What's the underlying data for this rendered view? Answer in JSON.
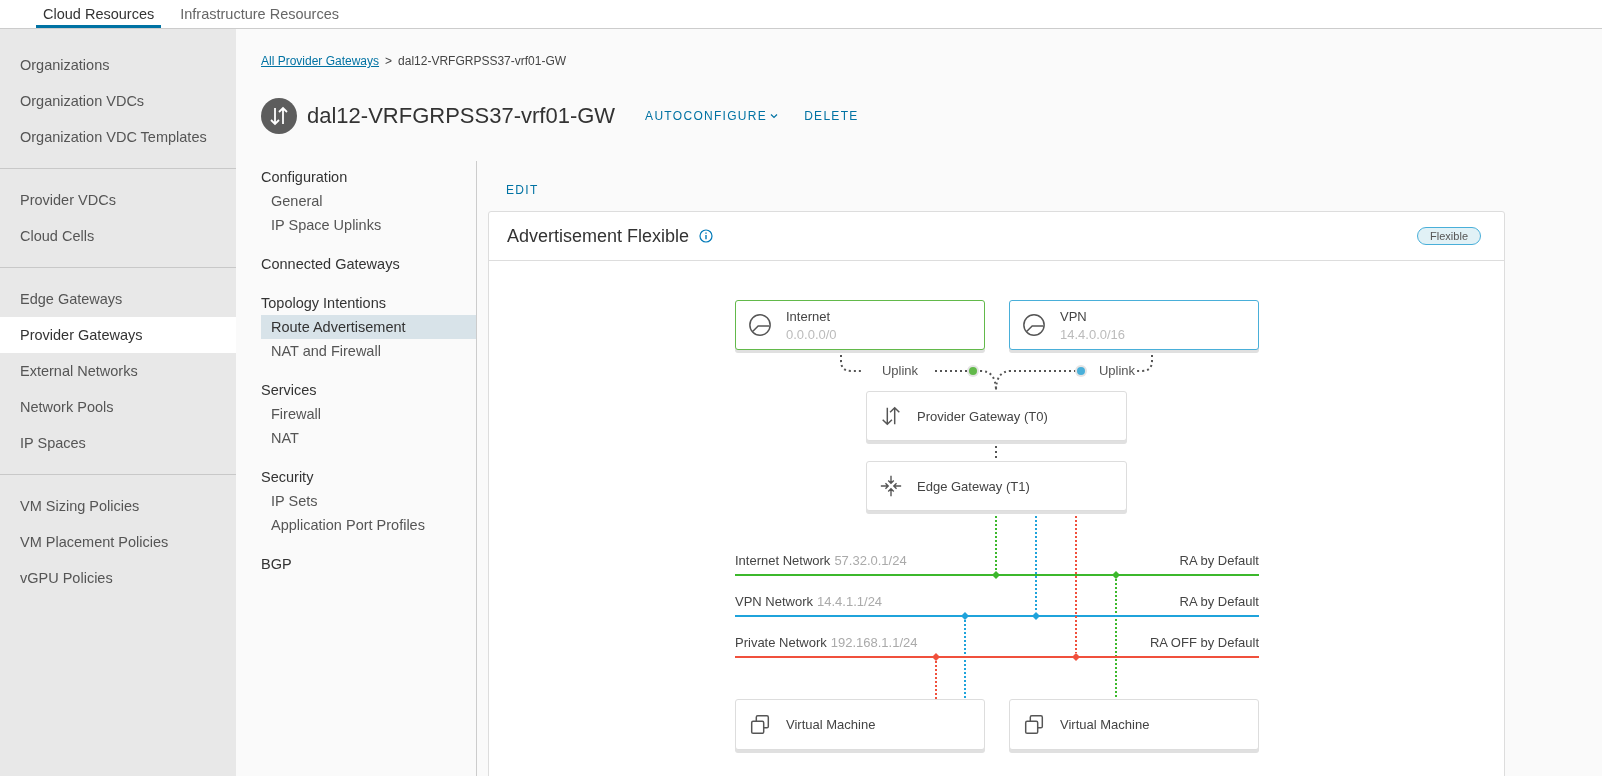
{
  "tabs": [
    {
      "label": "Cloud Resources",
      "selected": true
    },
    {
      "label": "Infrastructure Resources",
      "selected": false
    }
  ],
  "sidebar": {
    "groups": [
      {
        "items": [
          {
            "label": "Organizations",
            "selected": false
          },
          {
            "label": "Organization VDCs",
            "selected": false
          },
          {
            "label": "Organization VDC Templates",
            "selected": false
          }
        ]
      },
      {
        "items": [
          {
            "label": "Provider VDCs",
            "selected": false
          },
          {
            "label": "Cloud Cells",
            "selected": false
          }
        ]
      },
      {
        "items": [
          {
            "label": "Edge Gateways",
            "selected": false
          },
          {
            "label": "Provider Gateways",
            "selected": true
          },
          {
            "label": "External Networks",
            "selected": false
          },
          {
            "label": "Network Pools",
            "selected": false
          },
          {
            "label": "IP Spaces",
            "selected": false
          }
        ]
      },
      {
        "items": [
          {
            "label": "VM Sizing Policies",
            "selected": false
          },
          {
            "label": "VM Placement Policies",
            "selected": false
          },
          {
            "label": "vGPU Policies",
            "selected": false
          }
        ]
      }
    ]
  },
  "breadcrumb": {
    "link": "All Provider Gateways",
    "separator": ">",
    "current": "dal12-VRFGRPSS37-vrf01-GW"
  },
  "page_title": "dal12-VRFGRPSS37-vrf01-GW",
  "actions": [
    {
      "label": "AUTOCONFIGURE",
      "dropdown": true
    },
    {
      "label": "DELETE",
      "dropdown": false
    }
  ],
  "subnav": [
    {
      "heading": "Configuration",
      "items": [
        {
          "label": "General",
          "selected": false
        },
        {
          "label": "IP Space Uplinks",
          "selected": false
        }
      ]
    },
    {
      "heading": "Connected Gateways"
    },
    {
      "heading": "Topology Intentions",
      "items": [
        {
          "label": "Route Advertisement",
          "selected": true
        },
        {
          "label": "NAT and Firewall",
          "selected": false
        }
      ]
    },
    {
      "heading": "Services",
      "items": [
        {
          "label": "Firewall",
          "selected": false
        },
        {
          "label": "NAT",
          "selected": false
        }
      ]
    },
    {
      "heading": "Security",
      "items": [
        {
          "label": "IP Sets",
          "selected": false
        },
        {
          "label": "Application Port Profiles",
          "selected": false
        }
      ]
    },
    {
      "heading": "BGP"
    }
  ],
  "edit_button": "EDIT",
  "card": {
    "title": "Advertisement Flexible",
    "badge": "Flexible",
    "diagram": {
      "uplinks": [
        {
          "name": "Internet",
          "cidr": "0.0.0.0/0",
          "color": "#62b94a",
          "link_label": "Uplink"
        },
        {
          "name": "VPN",
          "cidr": "14.4.0.0/16",
          "color": "#49afd9",
          "link_label": "Uplink"
        }
      ],
      "provider_gateway": "Provider Gateway (T0)",
      "edge_gateway": "Edge Gateway (T1)",
      "networks": [
        {
          "name": "Internet Network",
          "cidr": "57.32.0.1/24",
          "status": "RA by Default",
          "color": "#3cb82c"
        },
        {
          "name": "VPN Network",
          "cidr": "14.4.1.1/24",
          "status": "RA by Default",
          "color": "#1fa3db"
        },
        {
          "name": "Private Network",
          "cidr": "192.168.1.1/24",
          "status": "RA OFF by Default",
          "color": "#f0503c"
        }
      ],
      "vms": [
        {
          "label": "Virtual Machine"
        },
        {
          "label": "Virtual Machine"
        }
      ]
    }
  }
}
